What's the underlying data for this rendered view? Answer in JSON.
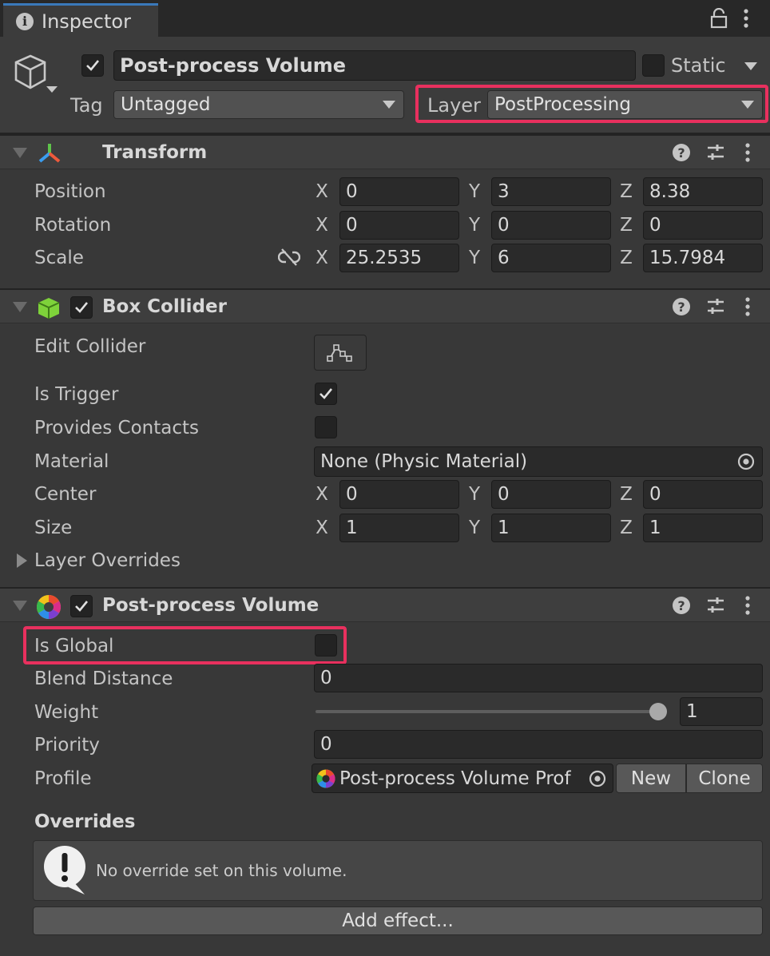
{
  "tab": {
    "title": "Inspector"
  },
  "header": {
    "object_name": "Post-process Volume",
    "static_label": "Static",
    "tag_label": "Tag",
    "tag_value": "Untagged",
    "layer_label": "Layer",
    "layer_value": "PostProcessing"
  },
  "axes": {
    "x": "X",
    "y": "Y",
    "z": "Z"
  },
  "transform": {
    "title": "Transform",
    "position": {
      "label": "Position",
      "x": "0",
      "y": "3",
      "z": "8.38"
    },
    "rotation": {
      "label": "Rotation",
      "x": "0",
      "y": "0",
      "z": "0"
    },
    "scale": {
      "label": "Scale",
      "x": "25.2535",
      "y": "6",
      "z": "15.7984"
    }
  },
  "box_collider": {
    "title": "Box Collider",
    "edit_collider": "Edit Collider",
    "is_trigger": "Is Trigger",
    "provides_contacts": "Provides Contacts",
    "material_label": "Material",
    "material_value": "None (Physic Material)",
    "center": {
      "label": "Center",
      "x": "0",
      "y": "0",
      "z": "0"
    },
    "size": {
      "label": "Size",
      "x": "1",
      "y": "1",
      "z": "1"
    },
    "layer_overrides": "Layer Overrides"
  },
  "volume": {
    "title": "Post-process Volume",
    "is_global": "Is Global",
    "blend_distance_label": "Blend Distance",
    "blend_distance_value": "0",
    "weight_label": "Weight",
    "weight_value": "1",
    "weight_fraction": 1,
    "priority_label": "Priority",
    "priority_value": "0",
    "profile_label": "Profile",
    "profile_value": "Post-process Volume Prof",
    "new_button": "New",
    "clone_button": "Clone",
    "overrides_title": "Overrides",
    "overrides_message": "No override set on this volume.",
    "add_effect_button": "Add effect..."
  }
}
